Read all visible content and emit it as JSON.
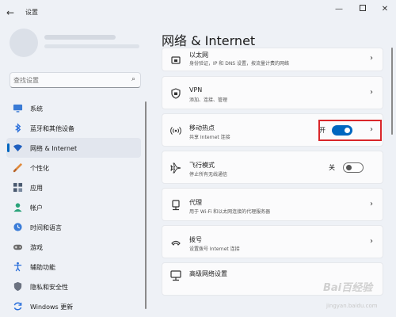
{
  "window": {
    "app_title": "设置",
    "back_glyph": "←",
    "min_glyph": "—",
    "close_glyph": "✕"
  },
  "search": {
    "placeholder": "查找设置"
  },
  "sidebar": {
    "items": [
      {
        "label": "系统",
        "icon": "monitor-icon",
        "color": "#3a7bd5"
      },
      {
        "label": "蓝牙和其他设备",
        "icon": "bluetooth-icon",
        "color": "#2a6fdb"
      },
      {
        "label": "网络 & Internet",
        "icon": "wifi-icon",
        "color": "#1f5fbf",
        "active": true
      },
      {
        "label": "个性化",
        "icon": "brush-icon",
        "color": "#e08a3c"
      },
      {
        "label": "应用",
        "icon": "apps-icon",
        "color": "#4a5a70"
      },
      {
        "label": "帐户",
        "icon": "person-icon",
        "color": "#2aa37a"
      },
      {
        "label": "时间和语言",
        "icon": "globe-clock-icon",
        "color": "#3b7dd8"
      },
      {
        "label": "游戏",
        "icon": "gamepad-icon",
        "color": "#6b6b6b"
      },
      {
        "label": "辅助功能",
        "icon": "accessibility-icon",
        "color": "#2a6fdb"
      },
      {
        "label": "隐私和安全性",
        "icon": "shield-icon",
        "color": "#6b7280"
      },
      {
        "label": "Windows 更新",
        "icon": "sync-icon",
        "color": "#2a6fdb"
      }
    ]
  },
  "main": {
    "page_title": "网络 & Internet",
    "cards": {
      "ethernet": {
        "title": "以太网",
        "desc": "身份验证，IP 和 DNS 设置，按流量计费的网络",
        "icon": "ethernet-icon"
      },
      "vpn": {
        "title": "VPN",
        "desc": "添加、连接、管理",
        "icon": "vpn-shield-icon"
      },
      "hotspot": {
        "title": "移动热点",
        "desc": "共享 Internet 连接",
        "icon": "hotspot-icon",
        "state": "开",
        "on": true
      },
      "airplane": {
        "title": "飞行模式",
        "desc": "停止所有无线通信",
        "icon": "airplane-icon",
        "state": "关",
        "on": false
      },
      "proxy": {
        "title": "代理",
        "desc": "用于 Wi-Fi 和以太网连接的代理服务器",
        "icon": "proxy-icon"
      },
      "dialup": {
        "title": "拨号",
        "desc": "设置拨号 Internet 连接",
        "icon": "dialup-icon"
      },
      "advanced": {
        "title": "高级网络设置",
        "desc": "",
        "icon": "network-pc-icon"
      }
    },
    "chevron": "›"
  },
  "watermark": {
    "line1": "Bai百经验",
    "line2": "jingyan.baidu.com"
  }
}
